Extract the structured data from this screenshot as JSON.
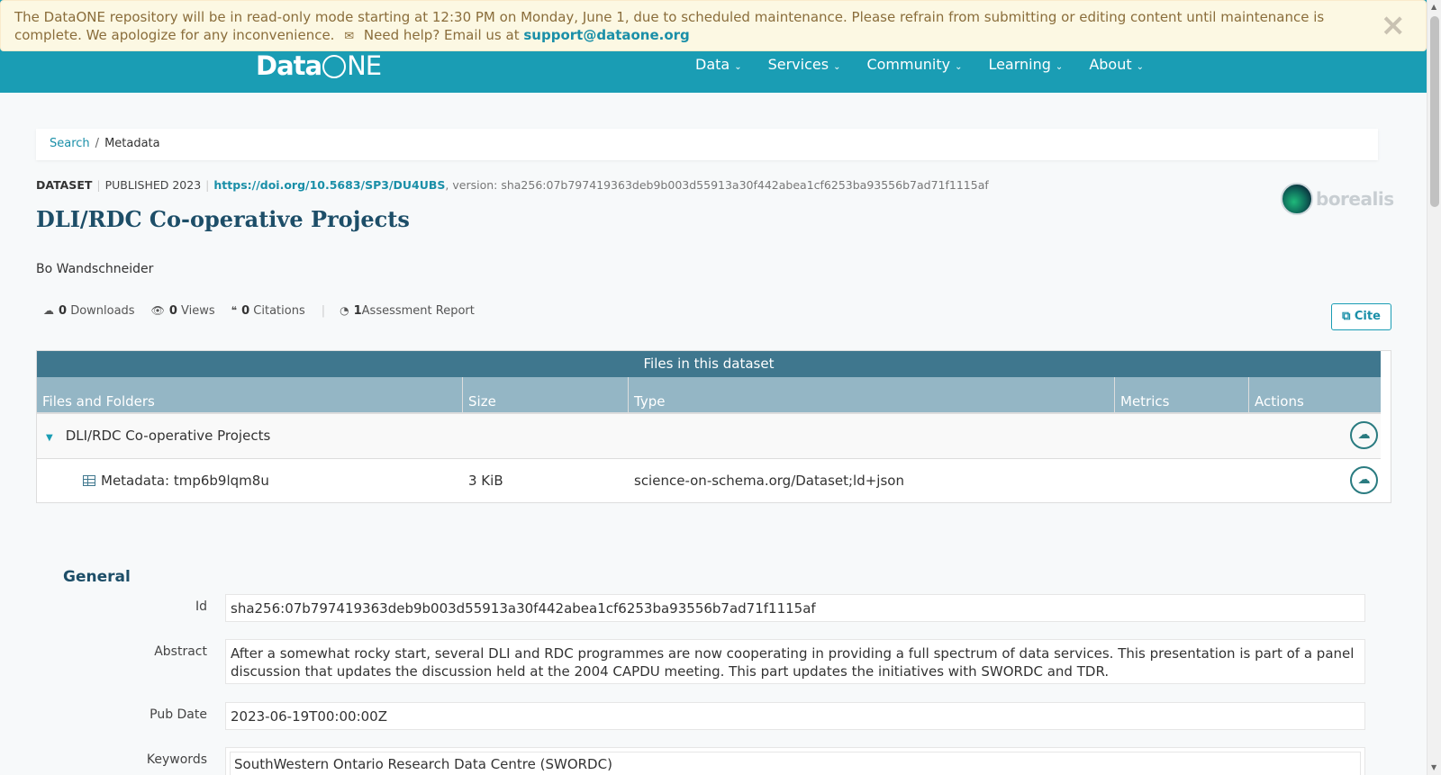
{
  "alert": {
    "message": "The DataONE repository will be in read-only mode starting at 12:30 PM on Monday, June 1, due to scheduled maintenance. Please refrain from submitting or editing content until maintenance is complete. We apologize for any inconvenience.",
    "help_text": "Need help? Email us at",
    "email": "support@dataone.org",
    "close": "×"
  },
  "header": {
    "logo_left": "Data",
    "logo_right": "NE",
    "nav": [
      "Data",
      "Services",
      "Community",
      "Learning",
      "About"
    ]
  },
  "breadcrumb": {
    "search": "Search",
    "current": "Metadata"
  },
  "dataset": {
    "type": "DATASET",
    "published": "PUBLISHED 2023",
    "doi": "https://doi.org/10.5683/SP3/DU4UBS",
    "version": ", version: sha256:07b797419363deb9b003d55913a30f442abea1cf6253ba93556b7ad71f1115af",
    "title": "DLI/RDC Co-operative Projects",
    "author": "Bo Wandschneider",
    "repo_logo": "borealis"
  },
  "metrics": {
    "downloads_count": "0",
    "downloads_label": "Downloads",
    "views_count": "0",
    "views_label": "Views",
    "citations_count": "0",
    "citations_label": "Citations",
    "assessment_count": "1",
    "assessment_label": "Assessment Report",
    "cite": "Cite"
  },
  "files": {
    "title": "Files in this dataset",
    "columns": [
      "Files and Folders",
      "Size",
      "Type",
      "Metrics",
      "Actions"
    ],
    "folder": "DLI/RDC Co-operative Projects",
    "rows": [
      {
        "name": "Metadata: tmp6b9lqm8u",
        "size": "3 KiB",
        "type": "science-on-schema.org/Dataset;ld+json"
      }
    ]
  },
  "general": {
    "title": "General",
    "id_label": "Id",
    "id": "sha256:07b797419363deb9b003d55913a30f442abea1cf6253ba93556b7ad71f1115af",
    "abstract_label": "Abstract",
    "abstract": "After a somewhat rocky start, several DLI and RDC programmes are now cooperating in providing a full spectrum of data services. This presentation is part of a panel discussion that updates the discussion held at the 2004 CAPDU meeting. This part updates the initiatives with SWORDC and TDR.",
    "pubdate_label": "Pub Date",
    "pubdate": "2023-06-19T00:00:00Z",
    "keywords_label": "Keywords",
    "keywords": [
      "SouthWestern Ontario Research Data Centre (SWORDC)"
    ]
  },
  "colors": {
    "header": "#1a9db4",
    "alert_bg": "#fcf8e3",
    "table_title": "#3f778e",
    "table_head": "#94b6c5",
    "title": "#1d4e68"
  }
}
